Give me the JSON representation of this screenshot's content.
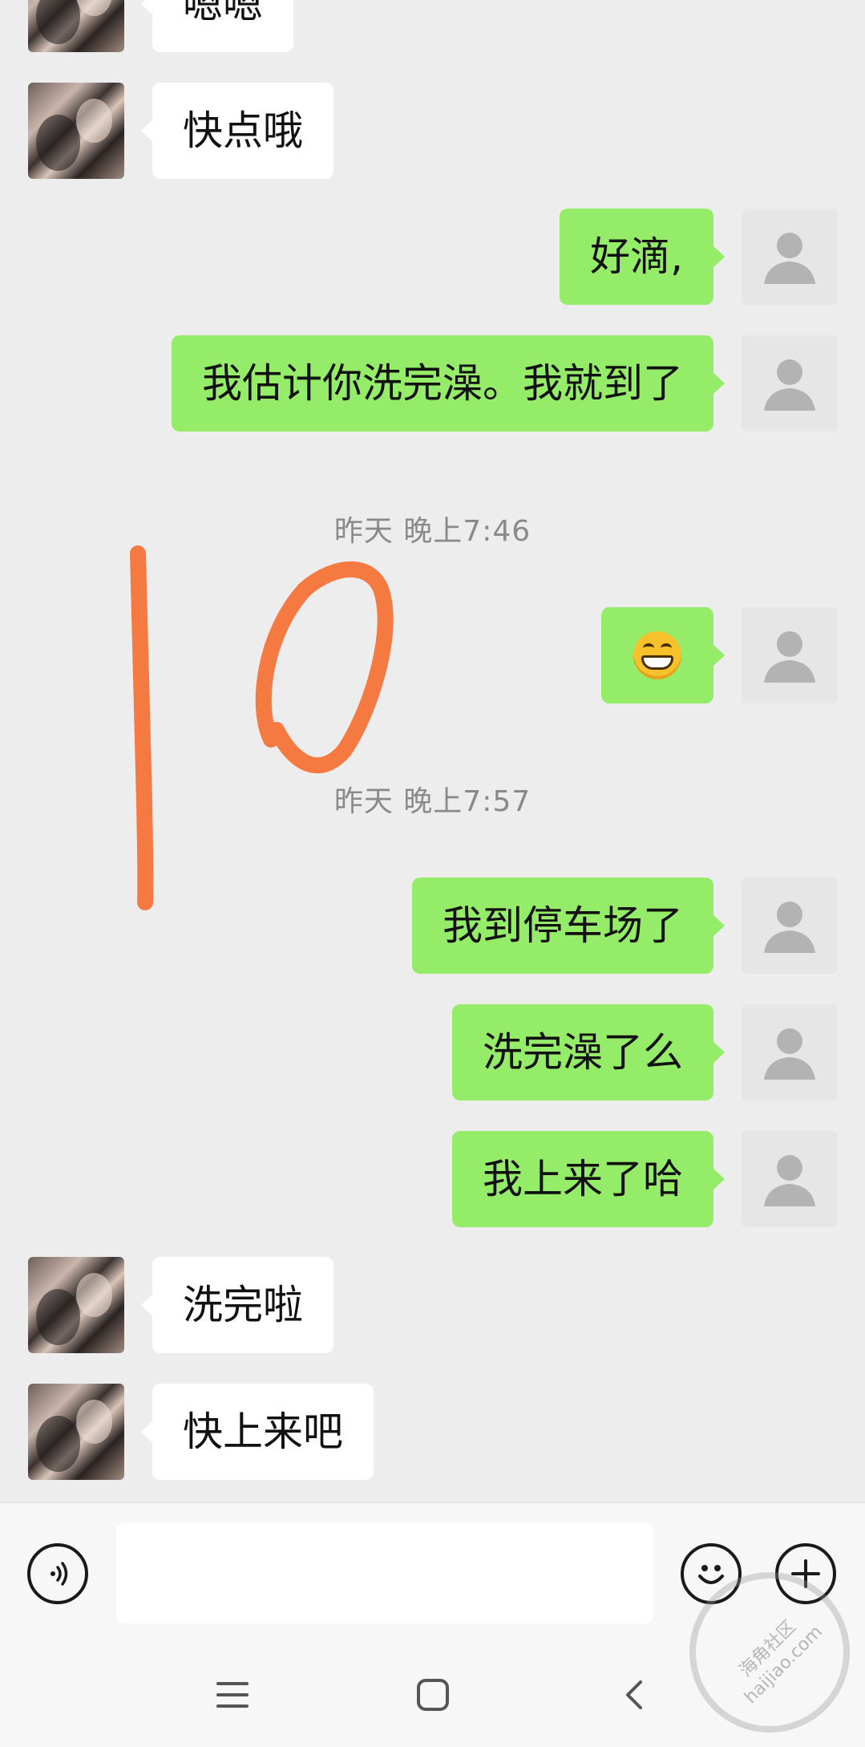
{
  "messages": [
    {
      "side": "in",
      "text": "嗯嗯"
    },
    {
      "side": "in",
      "text": "快点哦"
    },
    {
      "side": "out",
      "text": "好滴,"
    },
    {
      "side": "out",
      "text": "我估计你洗完澡。我就到了"
    },
    {
      "timestamp": "昨天 晚上7:46"
    },
    {
      "side": "out",
      "emoji": "grinning-face"
    },
    {
      "timestamp": "昨天 晚上7:57"
    },
    {
      "side": "out",
      "text": "我到停车场了"
    },
    {
      "side": "out",
      "text": "洗完澡了么"
    },
    {
      "side": "out",
      "text": "我上来了哈"
    },
    {
      "side": "in",
      "text": "洗完啦"
    },
    {
      "side": "in",
      "text": "快上来吧"
    }
  ],
  "annotation": {
    "text": "10",
    "color": "#f47a42"
  },
  "input_bar": {
    "value": "",
    "icons": [
      "voice-icon",
      "emoji-icon",
      "plus-icon"
    ]
  },
  "nav_bar": {
    "icons": [
      "menu-icon",
      "home-square-icon",
      "back-chevron-icon"
    ]
  },
  "watermark": {
    "line1": "海角社区",
    "line2": "haijiao.com"
  },
  "colors": {
    "background": "#ededed",
    "outgoing_bubble": "#95ec69",
    "incoming_bubble": "#ffffff",
    "timestamp": "#8a8a8a"
  }
}
